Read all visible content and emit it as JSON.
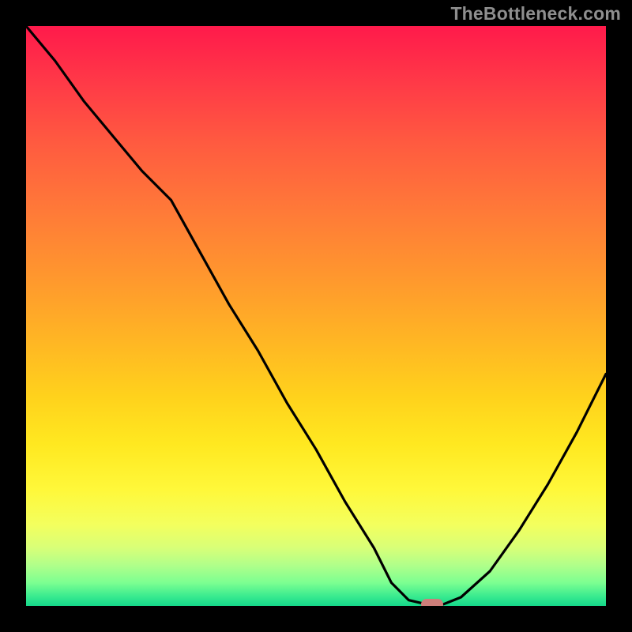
{
  "watermark": "TheBottleneck.com",
  "colors": {
    "frame": "#000000",
    "curve": "#000000",
    "marker": "#cd7e7a",
    "gradient_top": "#ff1a4b",
    "gradient_bottom": "#15d78a"
  },
  "chart_data": {
    "type": "line",
    "title": "",
    "xlabel": "",
    "ylabel": "",
    "xlim": [
      0,
      100
    ],
    "ylim": [
      0,
      100
    ],
    "x": [
      0,
      5,
      10,
      15,
      20,
      25,
      30,
      35,
      40,
      45,
      50,
      55,
      60,
      63,
      66,
      69,
      72,
      75,
      80,
      85,
      90,
      95,
      100
    ],
    "values": [
      100,
      94,
      87,
      81,
      75,
      70,
      61,
      52,
      44,
      35,
      27,
      18,
      10,
      4,
      1,
      0.3,
      0.3,
      1.5,
      6,
      13,
      21,
      30,
      40
    ],
    "annotations": [
      {
        "type": "marker",
        "x": 70,
        "y": 0.3,
        "shape": "pill",
        "color": "#cd7e7a"
      }
    ],
    "background": "vertical-gradient-red-to-green"
  }
}
